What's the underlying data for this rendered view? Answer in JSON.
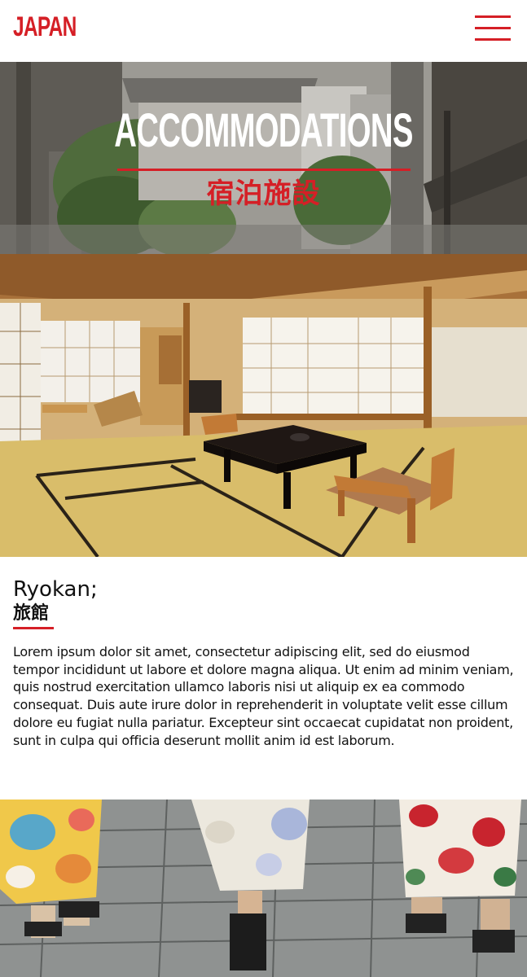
{
  "header": {
    "logo": "JAPAN",
    "menu_icon": "hamburger-menu-icon"
  },
  "hero": {
    "title": "ACCOMMODATIONS",
    "subtitle_jp": "宿泊施設"
  },
  "section": {
    "title": "Ryokan;",
    "title_jp": "旅館",
    "body": "Lorem ipsum dolor sit amet, consectetur adipiscing elit, sed do eiusmod tempor incididunt ut labore et dolore magna aliqua. Ut enim ad minim veniam, quis nostrud exercitation ullamco laboris nisi ut aliquip ex ea commodo consequat. Duis aute irure dolor in reprehenderit in voluptate velit esse cillum dolore eu fugiat nulla pariatur. Excepteur sint occaecat cupidatat non proident, sunt in culpa qui officia deserunt mollit anim id est laborum."
  },
  "colors": {
    "accent": "#d51f26",
    "text": "#111111",
    "background": "#ffffff"
  }
}
